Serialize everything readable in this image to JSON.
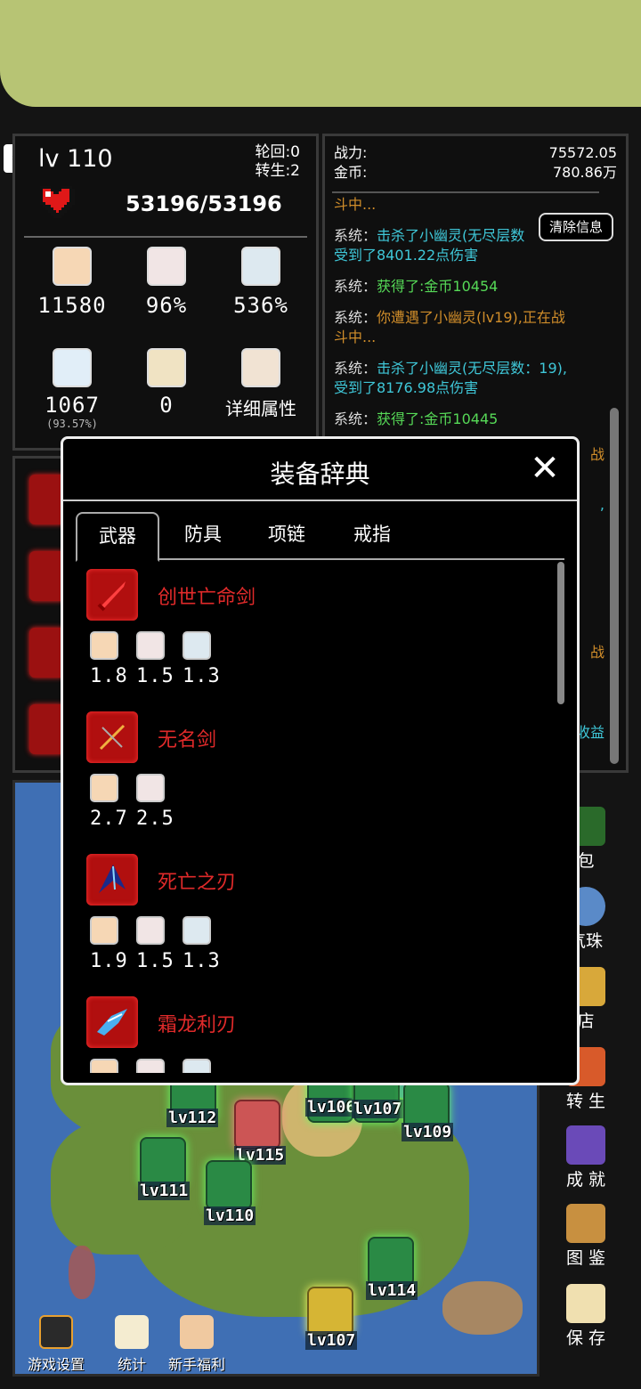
{
  "player": {
    "level": "lv 110",
    "lunhui": "轮回:0",
    "zhuansheng": "转生:2",
    "hp": "53196/53196",
    "attack": "11580",
    "crit_rate": "96%",
    "crit_damage": "536%",
    "defense": "1067",
    "defense_pct": "(93.57%)",
    "other": "0",
    "detail_label": "详细属性"
  },
  "summary": {
    "power_label": "战力:",
    "power_value": "75572.05",
    "gold_label": "金币:",
    "gold_value": "780.86万"
  },
  "log": {
    "clear_label": "清除信息",
    "top_fragment": "斗中...",
    "entries": [
      {
        "prefix": "系统：",
        "text": "击杀了小幽灵(无尽层数",
        "color": "#3fc7d8"
      },
      {
        "prefix": "",
        "text": "受到了8401.22点伤害",
        "color": "#3fc7d8"
      },
      {
        "prefix": "系统：",
        "text": "获得了:金币10454",
        "color": "#56d957"
      },
      {
        "prefix": "系统：",
        "text": "你遭遇了小幽灵(lv19),正在战",
        "color": "#d08d2a"
      },
      {
        "prefix": "",
        "text": "斗中...",
        "color": "#d08d2a"
      },
      {
        "prefix": "系统：",
        "text": "击杀了小幽灵(无尽层数：19),",
        "color": "#3fc7d8"
      },
      {
        "prefix": "",
        "text": "受到了8176.98点伤害",
        "color": "#3fc7d8"
      },
      {
        "prefix": "系统：",
        "text": "获得了:金币10445",
        "color": "#56d957"
      }
    ],
    "peek1": "战",
    "peek2": ",",
    "peek3": "战",
    "peek4": "收益"
  },
  "dialog": {
    "title": "装备辞典",
    "close": "✕",
    "tabs": [
      "武器",
      "防具",
      "项链",
      "戒指"
    ],
    "active_tab": 0,
    "items": [
      {
        "name": "创世亡命剑",
        "values": [
          "1.8",
          "1.5",
          "1.3"
        ]
      },
      {
        "name": "无名剑",
        "values": [
          "2.7",
          "2.5"
        ]
      },
      {
        "name": "死亡之刃",
        "values": [
          "1.9",
          "1.5",
          "1.3"
        ]
      },
      {
        "name": "霜龙利刃",
        "values": [
          "",
          "",
          ""
        ]
      }
    ]
  },
  "map": {
    "nodes": [
      {
        "label": "lv112",
        "kind": "green"
      },
      {
        "label": "lv115",
        "kind": "red"
      },
      {
        "label": "lv106",
        "kind": "green"
      },
      {
        "label": "lv107",
        "kind": "green"
      },
      {
        "label": "lv109",
        "kind": "green"
      },
      {
        "label": "lv111",
        "kind": "green"
      },
      {
        "label": "lv110",
        "kind": "green"
      },
      {
        "label": "lv114",
        "kind": "green"
      },
      {
        "label": "lv107",
        "kind": "gold"
      }
    ]
  },
  "bottom_buttons": [
    "游戏设置",
    "统计",
    "新手福利"
  ],
  "side_menu": [
    "包",
    "气珠",
    "店",
    "转 生",
    "成 就",
    "图 鉴",
    "保 存"
  ]
}
